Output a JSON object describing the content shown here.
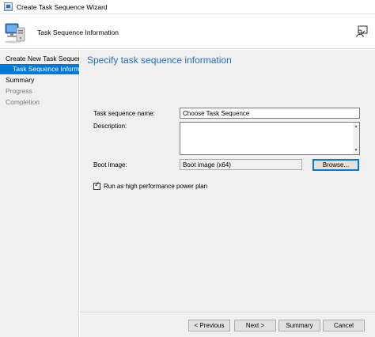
{
  "window": {
    "title": "Create Task Sequence Wizard"
  },
  "header": {
    "title": "Task Sequence Information",
    "icon": "computer-wizard-icon",
    "help_icon": "person-help-icon"
  },
  "sidebar": {
    "items": [
      {
        "label": "Create New Task Sequence",
        "state": "normal"
      },
      {
        "label": "Task Sequence Information",
        "state": "active"
      },
      {
        "label": "Summary",
        "state": "normal"
      },
      {
        "label": "Progress",
        "state": "disabled"
      },
      {
        "label": "Completion",
        "state": "disabled"
      }
    ]
  },
  "main": {
    "heading": "Specify task sequence information",
    "name_label": "Task sequence name:",
    "name_value": "Choose Task Sequence",
    "description_label": "Description:",
    "description_value": "",
    "boot_image_label": "Boot image:",
    "boot_image_value": "Boot image (x64)",
    "browse_label": "Browse...",
    "high_perf_label": "Run as high performance power plan",
    "high_perf_checked": true
  },
  "footer": {
    "previous_label": "< Previous",
    "next_label": "Next >",
    "summary_label": "Summary",
    "cancel_label": "Cancel"
  },
  "colors": {
    "accent": "#0078d7",
    "heading": "#1f6fc5",
    "panel_bg": "#f0f0f0"
  }
}
